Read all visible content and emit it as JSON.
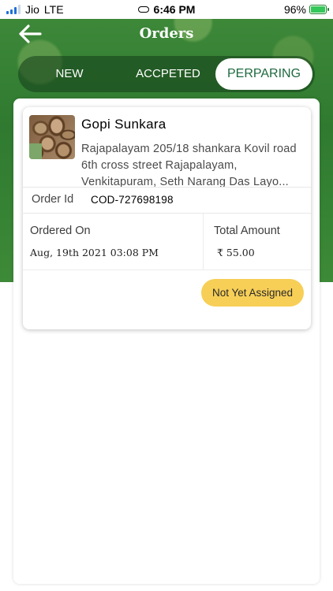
{
  "status_bar": {
    "carrier": "Jio",
    "network": "LTE",
    "time": "6:46 PM",
    "battery": "96%"
  },
  "header": {
    "title": "Orders",
    "back_icon": "arrow-left-icon"
  },
  "tabs": [
    {
      "label": "NEW",
      "active": false
    },
    {
      "label": "ACCPETED",
      "active": false
    },
    {
      "label": "PERPARING",
      "active": true
    }
  ],
  "orders": [
    {
      "customer_name": "Gopi Sunkara",
      "address": "Rajapalayam 205/18 shankara Kovil road 6th cross street Rajapalayam, Venkitapuram, Seth Narang Das Layo...",
      "order_id_label": "Order Id",
      "order_id": "COD-727698198",
      "ordered_on_label": "Ordered On",
      "ordered_on": "Aug, 19th 2021 03:08 PM",
      "total_amount_label": "Total Amount",
      "total_amount": "₹ 55.00",
      "status": "Not Yet Assigned"
    }
  ],
  "colors": {
    "header_green": "#3f8a3a",
    "active_tab_text": "#1e6a3e",
    "badge_yellow": "#f7cf57"
  }
}
